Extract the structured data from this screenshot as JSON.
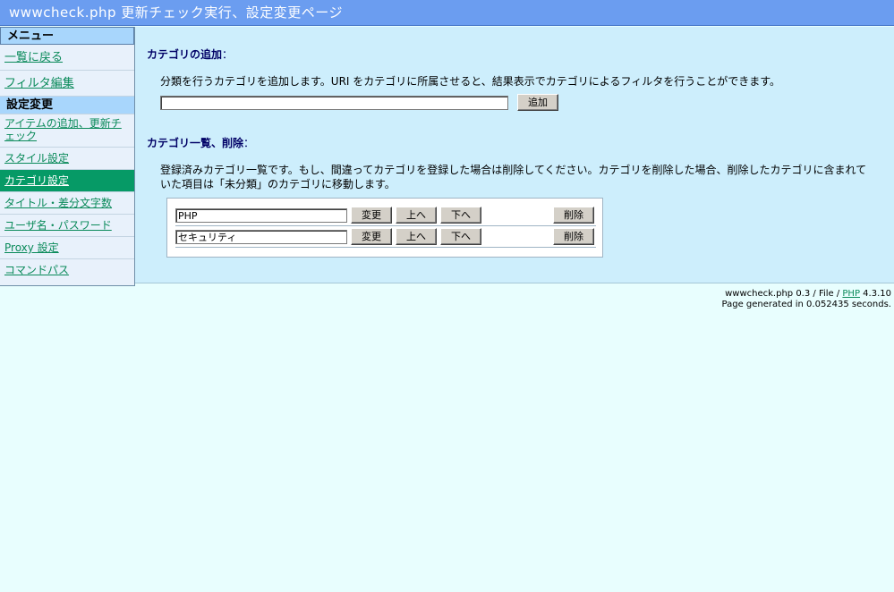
{
  "title": "wwwcheck.php 更新チェック実行、設定変更ページ",
  "sidebar": {
    "header": "メニュー",
    "items": [
      {
        "label": "一覧に戻る"
      },
      {
        "label": "フィルタ編集"
      }
    ],
    "section": "設定変更",
    "sub_items": [
      {
        "label": "アイテムの追加、更新チェック"
      },
      {
        "label": "スタイル設定"
      },
      {
        "label": "カテゴリ設定",
        "active": true
      },
      {
        "label": "タイトル・差分文字数"
      },
      {
        "label": "ユーザ名・パスワード"
      },
      {
        "label": "Proxy 設定"
      },
      {
        "label": "コマンドパス"
      }
    ]
  },
  "add_section": {
    "title": "カテゴリの追加",
    "colon": "：",
    "description": "分類を行うカテゴリを追加します。URI をカテゴリに所属させると、結果表示でカテゴリによるフィルタを行うことができます。",
    "input_value": "",
    "add_button": "追加"
  },
  "list_section": {
    "title": "カテゴリ一覧、削除",
    "colon": "：",
    "description": "登録済みカテゴリ一覧です。もし、間違ってカテゴリを登録した場合は削除してください。カテゴリを削除した場合、削除したカテゴリに含まれていた項目は「未分類」のカテゴリに移動します。",
    "categories": [
      {
        "name": "PHP"
      },
      {
        "name": "セキュリティ"
      }
    ],
    "buttons": {
      "change": "変更",
      "up": "上へ",
      "down": "下へ",
      "delete": "削除"
    }
  },
  "footer": {
    "line1_prefix": "wwwcheck.php 0.3 / File / ",
    "php_link": "PHP",
    "line1_suffix": " 4.3.10",
    "line2": "Page generated in 0.052435 seconds."
  },
  "colors": {
    "titlebar": "#6b9df0",
    "content_bg": "#cdeefc",
    "page_bg": "#e8fefe",
    "link": "#0a8a5a",
    "active": "#069a66",
    "heading": "#000066"
  }
}
